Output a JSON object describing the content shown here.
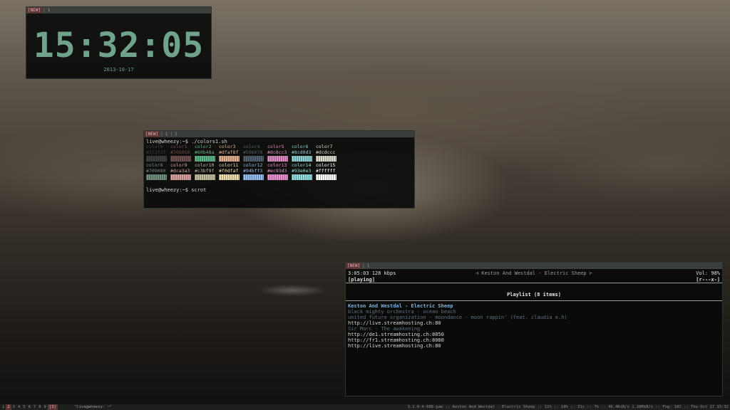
{
  "clock": {
    "tabs": [
      "[NEW]",
      "1"
    ],
    "time": "15:32:05",
    "date": "2013-10-17"
  },
  "terminal": {
    "tabs": [
      "[NEW]",
      "1",
      "2"
    ],
    "command1": "live@wheezy:~$ ./colors1.sh",
    "colors_row1": [
      {
        "name": "color0",
        "hex": "#3f3f3f",
        "color": "#3f3f3f"
      },
      {
        "name": "color1",
        "hex": "#705050",
        "color": "#705050"
      },
      {
        "name": "color2",
        "hex": "#60b48a",
        "color": "#60b48a"
      },
      {
        "name": "color3",
        "hex": "#dfaf8f",
        "color": "#dfaf8f"
      },
      {
        "name": "color4",
        "hex": "#506070",
        "color": "#506070"
      },
      {
        "name": "color5",
        "hex": "#dc8cc3",
        "color": "#dc8cc3"
      },
      {
        "name": "color6",
        "hex": "#8cd0d3",
        "color": "#8cd0d3"
      },
      {
        "name": "color7",
        "hex": "#dcdccc",
        "color": "#dcdccc"
      }
    ],
    "colors_row2": [
      {
        "name": "color8",
        "hex": "#709080",
        "color": "#709080"
      },
      {
        "name": "color9",
        "hex": "#dca3a3",
        "color": "#dca3a3"
      },
      {
        "name": "color10",
        "hex": "#c3bf9f",
        "color": "#c3bf9f"
      },
      {
        "name": "color11",
        "hex": "#f0dfaf",
        "color": "#f0dfaf"
      },
      {
        "name": "color12",
        "hex": "#94bff3",
        "color": "#94bff3"
      },
      {
        "name": "color13",
        "hex": "#ec93d3",
        "color": "#ec93d3"
      },
      {
        "name": "color14",
        "hex": "#93e0e3",
        "color": "#93e0e3"
      },
      {
        "name": "color15",
        "hex": "#ffffff",
        "color": "#ffffff"
      }
    ],
    "command2": "live@wheezy:~$ scrot"
  },
  "player": {
    "tabs": [
      "[NEW]",
      "1"
    ],
    "time_bitrate": "3:05:03 128 kbps",
    "state": "[playing]",
    "now_playing": "⊣ Keston And Westdal - Electric Sheep ⊢",
    "volume": "Vol: 98%",
    "flags": "[r---x-]",
    "playlist_header": "Playlist (8 items)",
    "playlist": [
      {
        "text": "Keston And Westdal - Electric Sheep",
        "style": "current"
      },
      {
        "text": "black mighty orchestra - ocean beach",
        "style": "dim"
      },
      {
        "text": "united future organization - moondance - moon rappin' (feat. claudia e.h)",
        "style": "dim"
      },
      {
        "text": "http://live.streamhosting.ch:80",
        "style": "normal"
      },
      {
        "text": "Sir Marc - The awakening",
        "style": "dim"
      },
      {
        "text": "http://de1.streamhosting.ch:8050",
        "style": "normal"
      },
      {
        "text": "http://fr1.streamhosting.ch:8080",
        "style": "normal"
      },
      {
        "text": "http://live.streamhosting.ch:80",
        "style": "normal"
      }
    ]
  },
  "statusbar": {
    "workspaces": [
      "1",
      "2",
      "3",
      "4",
      "5",
      "6",
      "7",
      "8",
      "9"
    ],
    "current_workspace": "2",
    "layout": "[3]",
    "title": "\"live@wheezy: ~\"",
    "right": "3.2.0-4-686-pae :: Keston And Westdal - Electric Sheep :: 11% :: 10% :: 31c :: 7% :: 46.4KiB/s 1.28MiB/s :: Fog: 10C :: Thu Oct 17 15:32"
  }
}
